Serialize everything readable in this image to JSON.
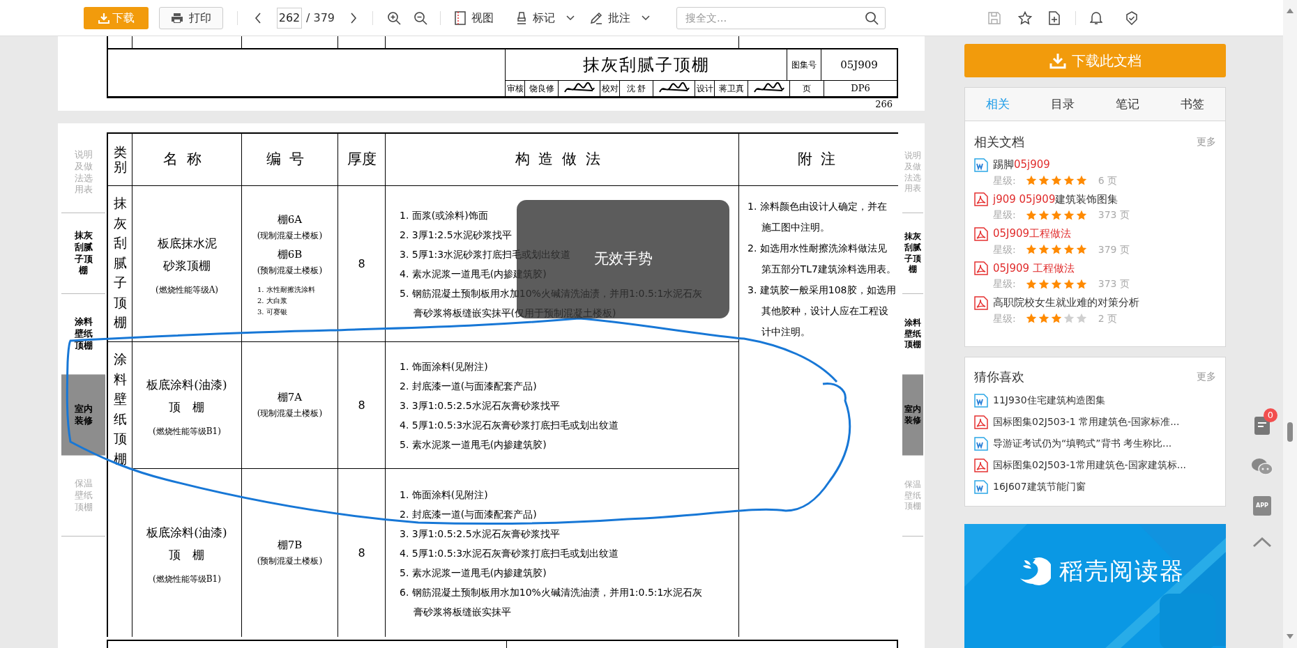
{
  "toolbar": {
    "download": "下载",
    "print": "打印",
    "page_current": "262",
    "page_total": "/ 379",
    "view": "视图",
    "mark": "标记",
    "annotate": "批注",
    "search_placeholder": "搜全文..."
  },
  "document": {
    "prev_page": {
      "title": "抹灰刮腻子顶棚",
      "atlas_label": "图集号",
      "atlas_no": "05J909",
      "signatures": [
        {
          "kind": "label",
          "text": "审核"
        },
        {
          "kind": "name",
          "text": "饶良修"
        },
        {
          "kind": "signature"
        },
        {
          "kind": "label",
          "text": "校对"
        },
        {
          "kind": "name",
          "text": "沈 舒"
        },
        {
          "kind": "signature"
        },
        {
          "kind": "label",
          "text": "设计"
        },
        {
          "kind": "name",
          "text": "蒋卫真"
        },
        {
          "kind": "signature"
        }
      ],
      "page_label": "页",
      "page_code": "DP6",
      "page_number": "266"
    },
    "side_tabs": [
      {
        "text": "说明及做法选用表",
        "kind": "faded"
      },
      {
        "text": "抹灰刮腻子顶棚",
        "kind": "normal"
      },
      {
        "text": "涂料壁纸顶棚",
        "kind": "normal"
      },
      {
        "text": "室内装修",
        "kind": "current"
      },
      {
        "text": "保温壁纸顶棚",
        "kind": "faded"
      }
    ],
    "side_tabs_right": [
      {
        "text": "说明及做法选用表",
        "kind": "faded"
      },
      {
        "text": "抹灰刮腻子顶棚",
        "kind": "normal"
      },
      {
        "text": "涂料壁纸顶棚",
        "kind": "normal"
      },
      {
        "text": "室内装修",
        "kind": "current"
      },
      {
        "text": "保温壁纸顶棚",
        "kind": "faded"
      }
    ],
    "table": {
      "columns": [
        "类别",
        "名称",
        "编号",
        "厚度",
        "构造做法",
        "附注"
      ],
      "categories": [
        {
          "text": "抹灰刮腻子顶棚"
        },
        {
          "text": "涂料壁纸顶棚"
        }
      ],
      "rows": [
        {
          "name_lines": [
            "板底抹水泥",
            "砂浆顶棚"
          ],
          "fire_rating": "(燃烧性能等级A)",
          "codes": [
            {
              "code": "棚6A",
              "slab": "(现制混凝土楼板)"
            },
            {
              "code": "棚6B",
              "slab": "(预制混凝土楼板)"
            }
          ],
          "options": [
            "1. 水性耐擦洗涂料",
            "2. 大白浆",
            "3. 可赛银"
          ],
          "thickness": "8",
          "steps": [
            "1. 面浆(或涂料)饰面",
            "2. 3厚1:2.5水泥砂浆找平",
            "3. 5厚1:3水泥砂浆打底扫毛或划出纹道",
            "4. 素水泥浆一道甩毛(内掺建筑胶)",
            "5. 钢筋混凝土预制板用水加10%火碱清洗油渍，并用1:0.5:1水泥石灰膏砂浆将板缝嵌实抹平(仅用于预制混凝土楼板)"
          ]
        },
        {
          "name_lines": [
            "板底涂料(油漆)",
            "顶　棚"
          ],
          "fire_rating": "(燃烧性能等级B1)",
          "codes": [
            {
              "code": "棚7A",
              "slab": "(现制混凝土楼板)"
            }
          ],
          "thickness": "8",
          "steps": [
            "1. 饰面涂料(见附注)",
            "2. 封底漆一道(与面漆配套产品)",
            "3. 3厚1:0.5:2.5水泥石灰膏砂浆找平",
            "4. 5厚1:0.5:3水泥石灰膏砂浆打底扫毛或划出纹道",
            "5. 素水泥浆一道甩毛(内掺建筑胶)"
          ]
        },
        {
          "name_lines": [
            "板底涂料(油漆)",
            "顶　棚"
          ],
          "fire_rating": "(燃烧性能等级B1)",
          "codes": [
            {
              "code": "棚7B",
              "slab": "(预制混凝土楼板)"
            }
          ],
          "thickness": "8",
          "steps": [
            "1. 饰面涂料(见附注)",
            "2. 封底漆一道(与面漆配套产品)",
            "3. 3厚1:0.5:2.5水泥石灰膏砂浆找平",
            "4. 5厚1:0.5:3水泥石灰膏砂浆打底扫毛或划出纹道",
            "5. 素水泥浆一道甩毛(内掺建筑胶)",
            "6. 钢筋混凝土预制板用水加10%火碱清洗油渍，并用1:0.5:1水泥石灰膏砂浆将板缝嵌实抹平"
          ]
        }
      ],
      "notes": [
        "1. 涂料颜色由设计人确定，并在施工图中注明。",
        "2. 如选用水性耐擦洗涂料做法见第五部分TL7建筑涂料选用表。",
        "3. 建筑胶一般采用108胶，如选用其他胶种，设计人应在工程设计中注明。"
      ]
    }
  },
  "toast": {
    "text": "无效手势"
  },
  "sidebar": {
    "download": "下载此文档",
    "tabs": [
      {
        "label": "相关",
        "selected": true
      },
      {
        "label": "目录",
        "selected": false
      },
      {
        "label": "笔记",
        "selected": false
      },
      {
        "label": "书签",
        "selected": false
      }
    ],
    "related": {
      "title": "相关文档",
      "more": "更多",
      "items": [
        {
          "kind": "doc",
          "title": [
            {
              "text": "踢脚",
              "match": false
            },
            {
              "text": "05j909",
              "match": true
            }
          ],
          "rating_label": "星级:",
          "stars": 5,
          "pages": "6 页"
        },
        {
          "kind": "pdf",
          "title": [
            {
              "text": "j909 05j909",
              "match": true
            },
            {
              "text": "建筑装饰图集",
              "match": false
            }
          ],
          "rating_label": "星级:",
          "stars": 5,
          "pages": "373 页"
        },
        {
          "kind": "pdf",
          "title": [
            {
              "text": "05J909工程做法",
              "match": true
            }
          ],
          "rating_label": "星级:",
          "stars": 5,
          "pages": "379 页"
        },
        {
          "kind": "pdf",
          "title": [
            {
              "text": "05J909 工程做法",
              "match": true
            }
          ],
          "rating_label": "星级:",
          "stars": 5,
          "pages": "373 页"
        },
        {
          "kind": "pdf",
          "title": [
            {
              "text": "高职院校女生就业难的对策分析",
              "match": false
            }
          ],
          "rating_label": "星级:",
          "stars": 3,
          "pages": "2 页"
        }
      ]
    },
    "guess": {
      "title": "猜你喜欢",
      "more": "更多",
      "items": [
        {
          "kind": "doc",
          "title": "11J930住宅建筑构造图集"
        },
        {
          "kind": "pdf",
          "title": "国标图集02J503-1 常用建筑色-国家标准..."
        },
        {
          "kind": "doc",
          "title": "导游证考试仍为“填鸭式”背书 考生称比..."
        },
        {
          "kind": "pdf",
          "title": "国标图集02J503-1常用建筑色-国家建筑标..."
        },
        {
          "kind": "doc",
          "title": "16J607建筑节能门窗"
        }
      ]
    },
    "banner": {
      "title": "稻壳阅读器"
    }
  },
  "float_tools": {
    "badge": "0",
    "app_label": "APP"
  }
}
